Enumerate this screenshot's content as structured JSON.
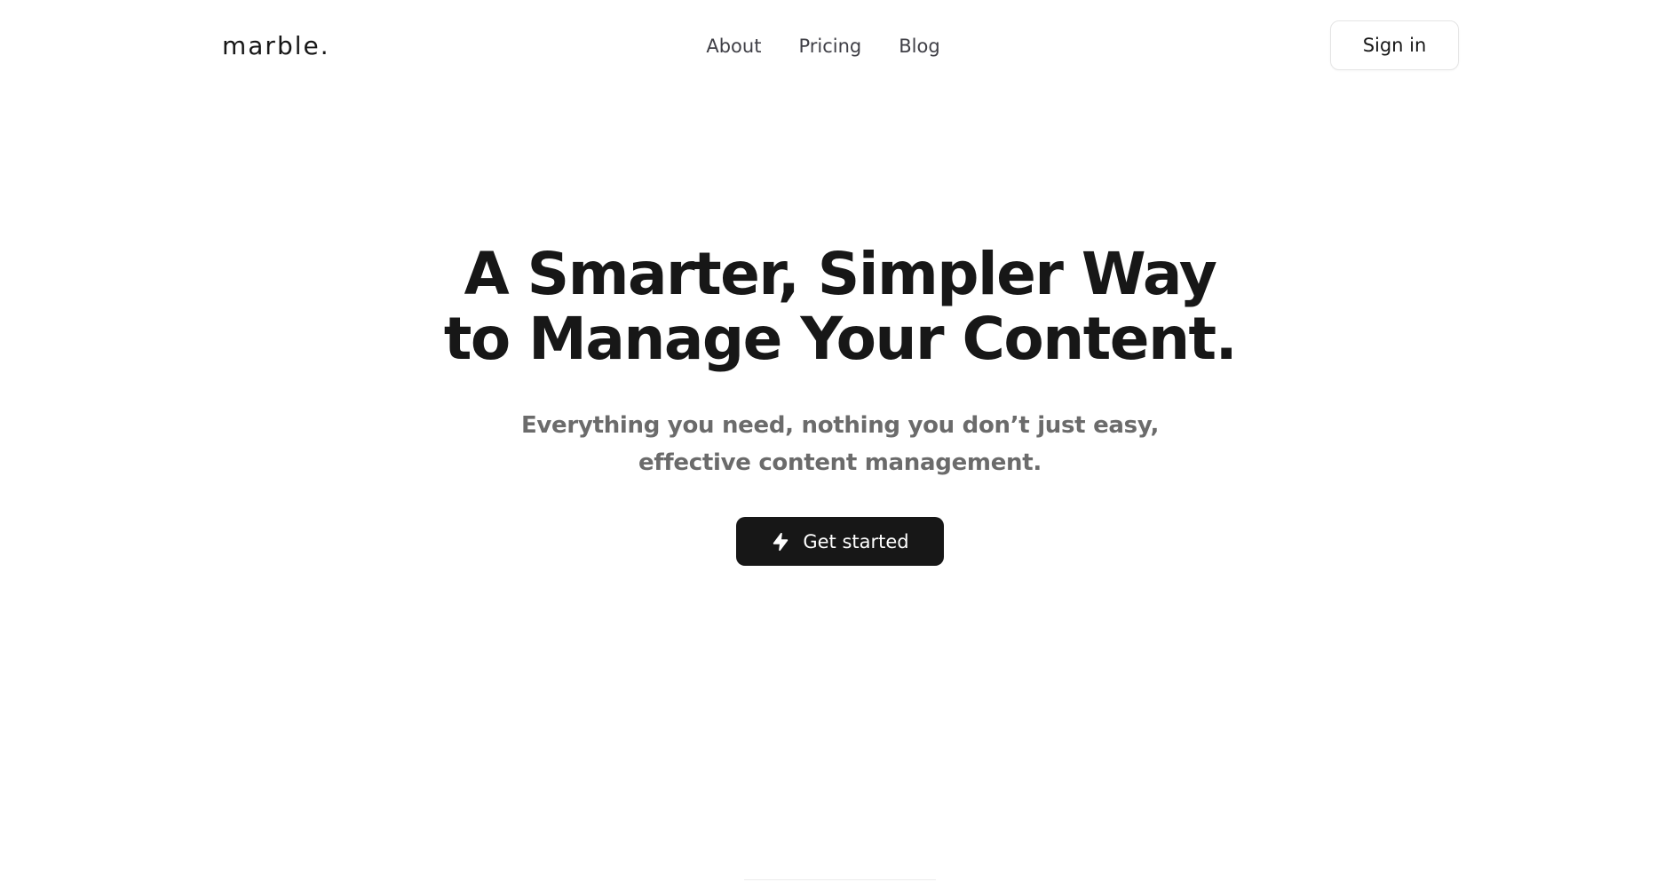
{
  "header": {
    "logo": "marble.",
    "nav": [
      {
        "label": "About"
      },
      {
        "label": "Pricing"
      },
      {
        "label": "Blog"
      }
    ],
    "signin_label": "Sign in"
  },
  "hero": {
    "title_line1": "A Smarter, Simpler Way",
    "title_line2": "to Manage Your Content.",
    "subtitle": "Everything you need, nothing you don’t just easy, effective content management.",
    "cta_label": "Get started",
    "cta_icon": "lightning-bolt-icon"
  },
  "colors": {
    "background": "#ffffff",
    "text": "#171717",
    "muted_text": "#6b6b6b",
    "button_dark": "#171717",
    "border": "#e5e5e5"
  }
}
